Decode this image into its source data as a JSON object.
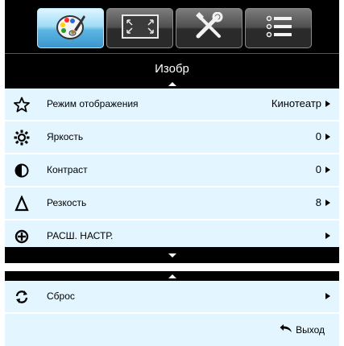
{
  "tabs": [
    {
      "name": "picture",
      "icon": "palette-icon",
      "active": true
    },
    {
      "name": "display",
      "icon": "screen-frame-icon",
      "active": false
    },
    {
      "name": "setup",
      "icon": "tools-icon",
      "active": false
    },
    {
      "name": "options",
      "icon": "list-icon",
      "active": false
    }
  ],
  "header": {
    "title": "Изобр"
  },
  "menu": {
    "items": [
      {
        "label": "Режим отображения",
        "value": "Кинотеатр",
        "icon": "star-icon"
      },
      {
        "label": "Яркость",
        "value": "0",
        "icon": "brightness-icon"
      },
      {
        "label": "Контраст",
        "value": "0",
        "icon": "contrast-icon"
      },
      {
        "label": "Резкость",
        "value": "8",
        "icon": "sharpness-icon"
      },
      {
        "label": "РАСШ. НАСТР.",
        "value": "",
        "icon": "advanced-settings-icon"
      }
    ]
  },
  "reset": {
    "label": "Сброс",
    "icon": "reset-icon"
  },
  "footer": {
    "exit_label": "Выход",
    "exit_icon": "return-arrow-icon"
  },
  "colors": {
    "row_bg": "#e3f6ff",
    "active_tab": "#7ccbef",
    "bar_bg": "#000000"
  }
}
